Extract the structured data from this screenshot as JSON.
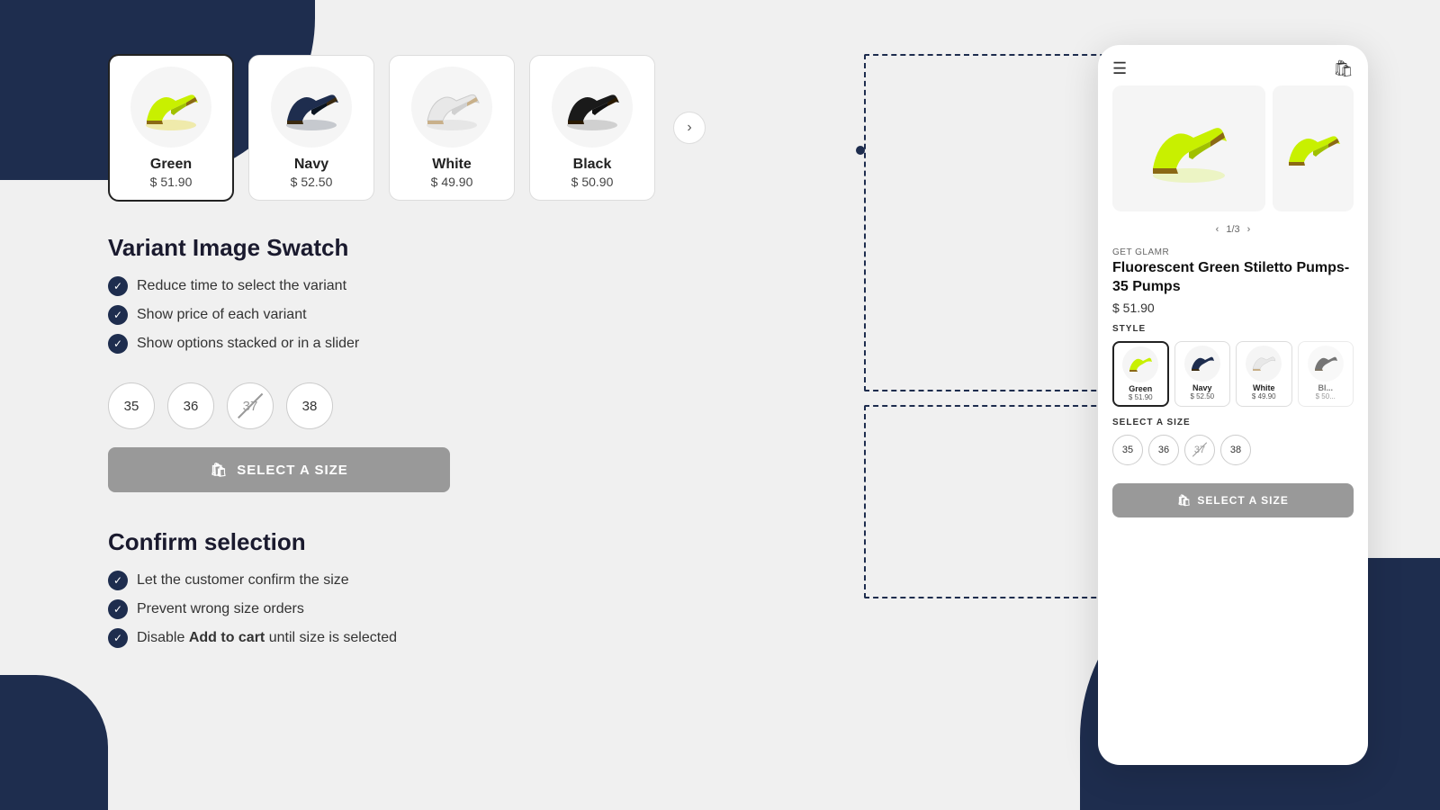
{
  "background": {
    "color": "#f0f0f0",
    "accent": "#1e2d4e"
  },
  "swatches": [
    {
      "id": "green",
      "label": "Green",
      "price": "$ 51.90",
      "selected": true,
      "color": "green"
    },
    {
      "id": "navy",
      "label": "Navy",
      "price": "$ 52.50",
      "selected": false,
      "color": "navy"
    },
    {
      "id": "white",
      "label": "White",
      "price": "$ 49.90",
      "selected": false,
      "color": "white"
    },
    {
      "id": "black",
      "label": "Black",
      "price": "$ 50.90",
      "selected": false,
      "color": "black"
    }
  ],
  "feature1": {
    "title": "Variant Image Swatch",
    "items": [
      "Reduce time to select the variant",
      "Show price of each variant",
      "Show options stacked or in a slider"
    ]
  },
  "sizes": [
    "35",
    "36",
    "37",
    "38"
  ],
  "size_strikethrough": "37",
  "select_size_label": "SELECT A SIZE",
  "feature2": {
    "title": "Confirm selection",
    "items": [
      "Let the customer confirm the size",
      "Prevent wrong size orders",
      "Disable {bold:Add to cart} until size is selected"
    ]
  },
  "mobile": {
    "brand": "GET GLAMR",
    "product_name": "Fluorescent Green Stiletto Pumps- 35 Pumps",
    "price": "$ 51.90",
    "pagination": "1/3",
    "style_label": "STYLE",
    "size_label": "SELECT A SIZE",
    "select_size_btn": "SELECT A SIZE",
    "swatches": [
      {
        "label": "Green",
        "price": "$ 51.90",
        "selected": true
      },
      {
        "label": "Navy",
        "price": "$ 52.50",
        "selected": false
      },
      {
        "label": "White",
        "price": "$ 49.90",
        "selected": false
      },
      {
        "label": "Bl...",
        "price": "$ 50...",
        "selected": false
      }
    ],
    "sizes": [
      "35",
      "36",
      "37",
      "38"
    ],
    "size_strikethrough": "37"
  },
  "icons": {
    "hamburger": "☰",
    "cart": "🛍",
    "check": "✓",
    "chevron_right": "›",
    "chevron_left": "‹",
    "bag": "🛍"
  }
}
